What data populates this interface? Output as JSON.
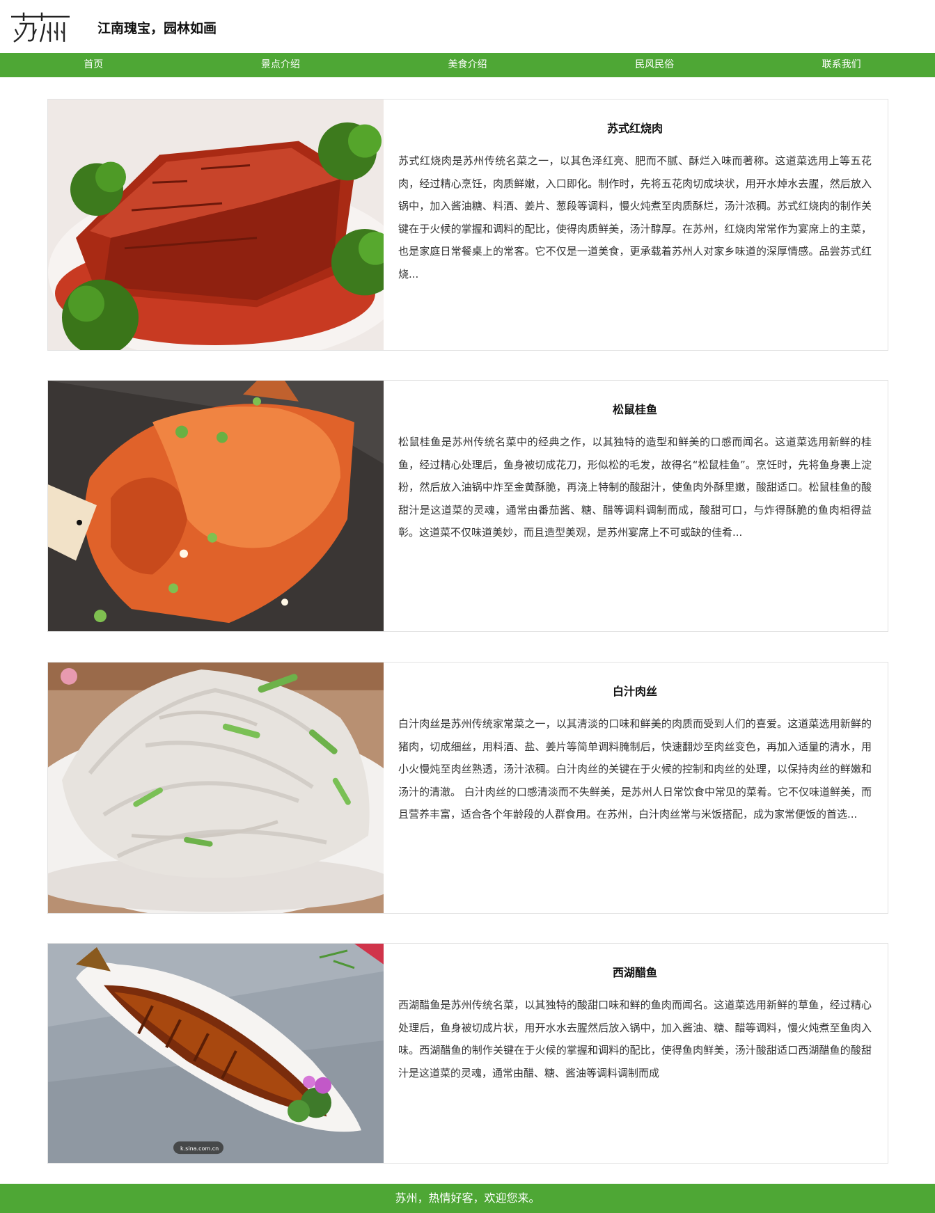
{
  "header": {
    "logo_text": "苏州",
    "tagline": "江南瑰宝，园林如画"
  },
  "nav": {
    "items": [
      {
        "label": "首页"
      },
      {
        "label": "景点介绍"
      },
      {
        "label": "美食介绍"
      },
      {
        "label": "民风民俗"
      },
      {
        "label": "联系我们"
      }
    ]
  },
  "dishes": [
    {
      "title": "苏式红烧肉",
      "description": "苏式红烧肉是苏州传统名菜之一，以其色泽红亮、肥而不腻、酥烂入味而著称。这道菜选用上等五花肉，经过精心烹饪，肉质鲜嫩，入口即化。制作时，先将五花肉切成块状，用开水焯水去腥，然后放入锅中，加入酱油糖、料酒、姜片、葱段等调料，慢火炖煮至肉质酥烂，汤汁浓稠。苏式红烧肉的制作关键在于火候的掌握和调料的配比，使得肉质鲜美，汤汁醇厚。在苏州，红烧肉常常作为宴席上的主菜，也是家庭日常餐桌上的常客。它不仅是一道美食，更承载着苏州人对家乡味道的深厚情感。品尝苏式红烧...",
      "image": "braised-pork-photo"
    },
    {
      "title": "松鼠桂鱼",
      "description": "松鼠桂鱼是苏州传统名菜中的经典之作，以其独特的造型和鲜美的口感而闻名。这道菜选用新鲜的桂鱼，经过精心处理后，鱼身被切成花刀，形似松的毛发，故得名“松鼠桂鱼”。烹饪时，先将鱼身裹上淀粉，然后放入油锅中炸至金黄酥脆，再浇上特制的酸甜汁，使鱼肉外酥里嫩，酸甜适口。松鼠桂鱼的酸甜汁是这道菜的灵魂，通常由番茄酱、糖、醋等调料调制而成，酸甜可口，与炸得酥脆的鱼肉相得益彰。这道菜不仅味道美妙，而且造型美观，是苏州宴席上不可或缺的佳肴...",
      "image": "squirrel-fish-photo"
    },
    {
      "title": "白汁肉丝",
      "description": "白汁肉丝是苏州传统家常菜之一，以其清淡的口味和鲜美的肉质而受到人们的喜爱。这道菜选用新鲜的猪肉，切成细丝，用料酒、盐、姜片等简单调料腌制后，快速翻炒至肉丝变色，再加入适量的清水，用小火慢炖至肉丝熟透，汤汁浓稠。白汁肉丝的关键在于火候的控制和肉丝的处理，以保持肉丝的鲜嫩和汤汁的清澈。 白汁肉丝的口感清淡而不失鲜美，是苏州人日常饮食中常见的菜肴。它不仅味道鲜美，而且营养丰富，适合各个年龄段的人群食用。在苏州，白汁肉丝常与米饭搭配，成为家常便饭的首选...",
      "image": "shredded-pork-photo"
    },
    {
      "title": "西湖醋鱼",
      "description": "西湖醋鱼是苏州传统名菜，以其独特的酸甜口味和鲜的鱼肉而闻名。这道菜选用新鲜的草鱼，经过精心处理后，鱼身被切成片状，用开水水去腥然后放入锅中，加入酱油、糖、醋等调料，慢火炖煮至鱼肉入味。西湖醋鱼的制作关键在于火候的掌握和调料的配比，使得鱼肉鲜美，汤汁酸甜适口西湖醋鱼的酸甜汁是这道菜的灵魂，通常由醋、糖、酱油等调料调制而成",
      "image": "vinegar-fish-photo",
      "watermark": "k.sina.com.cn"
    }
  ],
  "footer": {
    "text": "苏州，热情好客，欢迎您来。"
  },
  "colors": {
    "brand_green": "#4ea735",
    "border": "#e2e2e2"
  }
}
